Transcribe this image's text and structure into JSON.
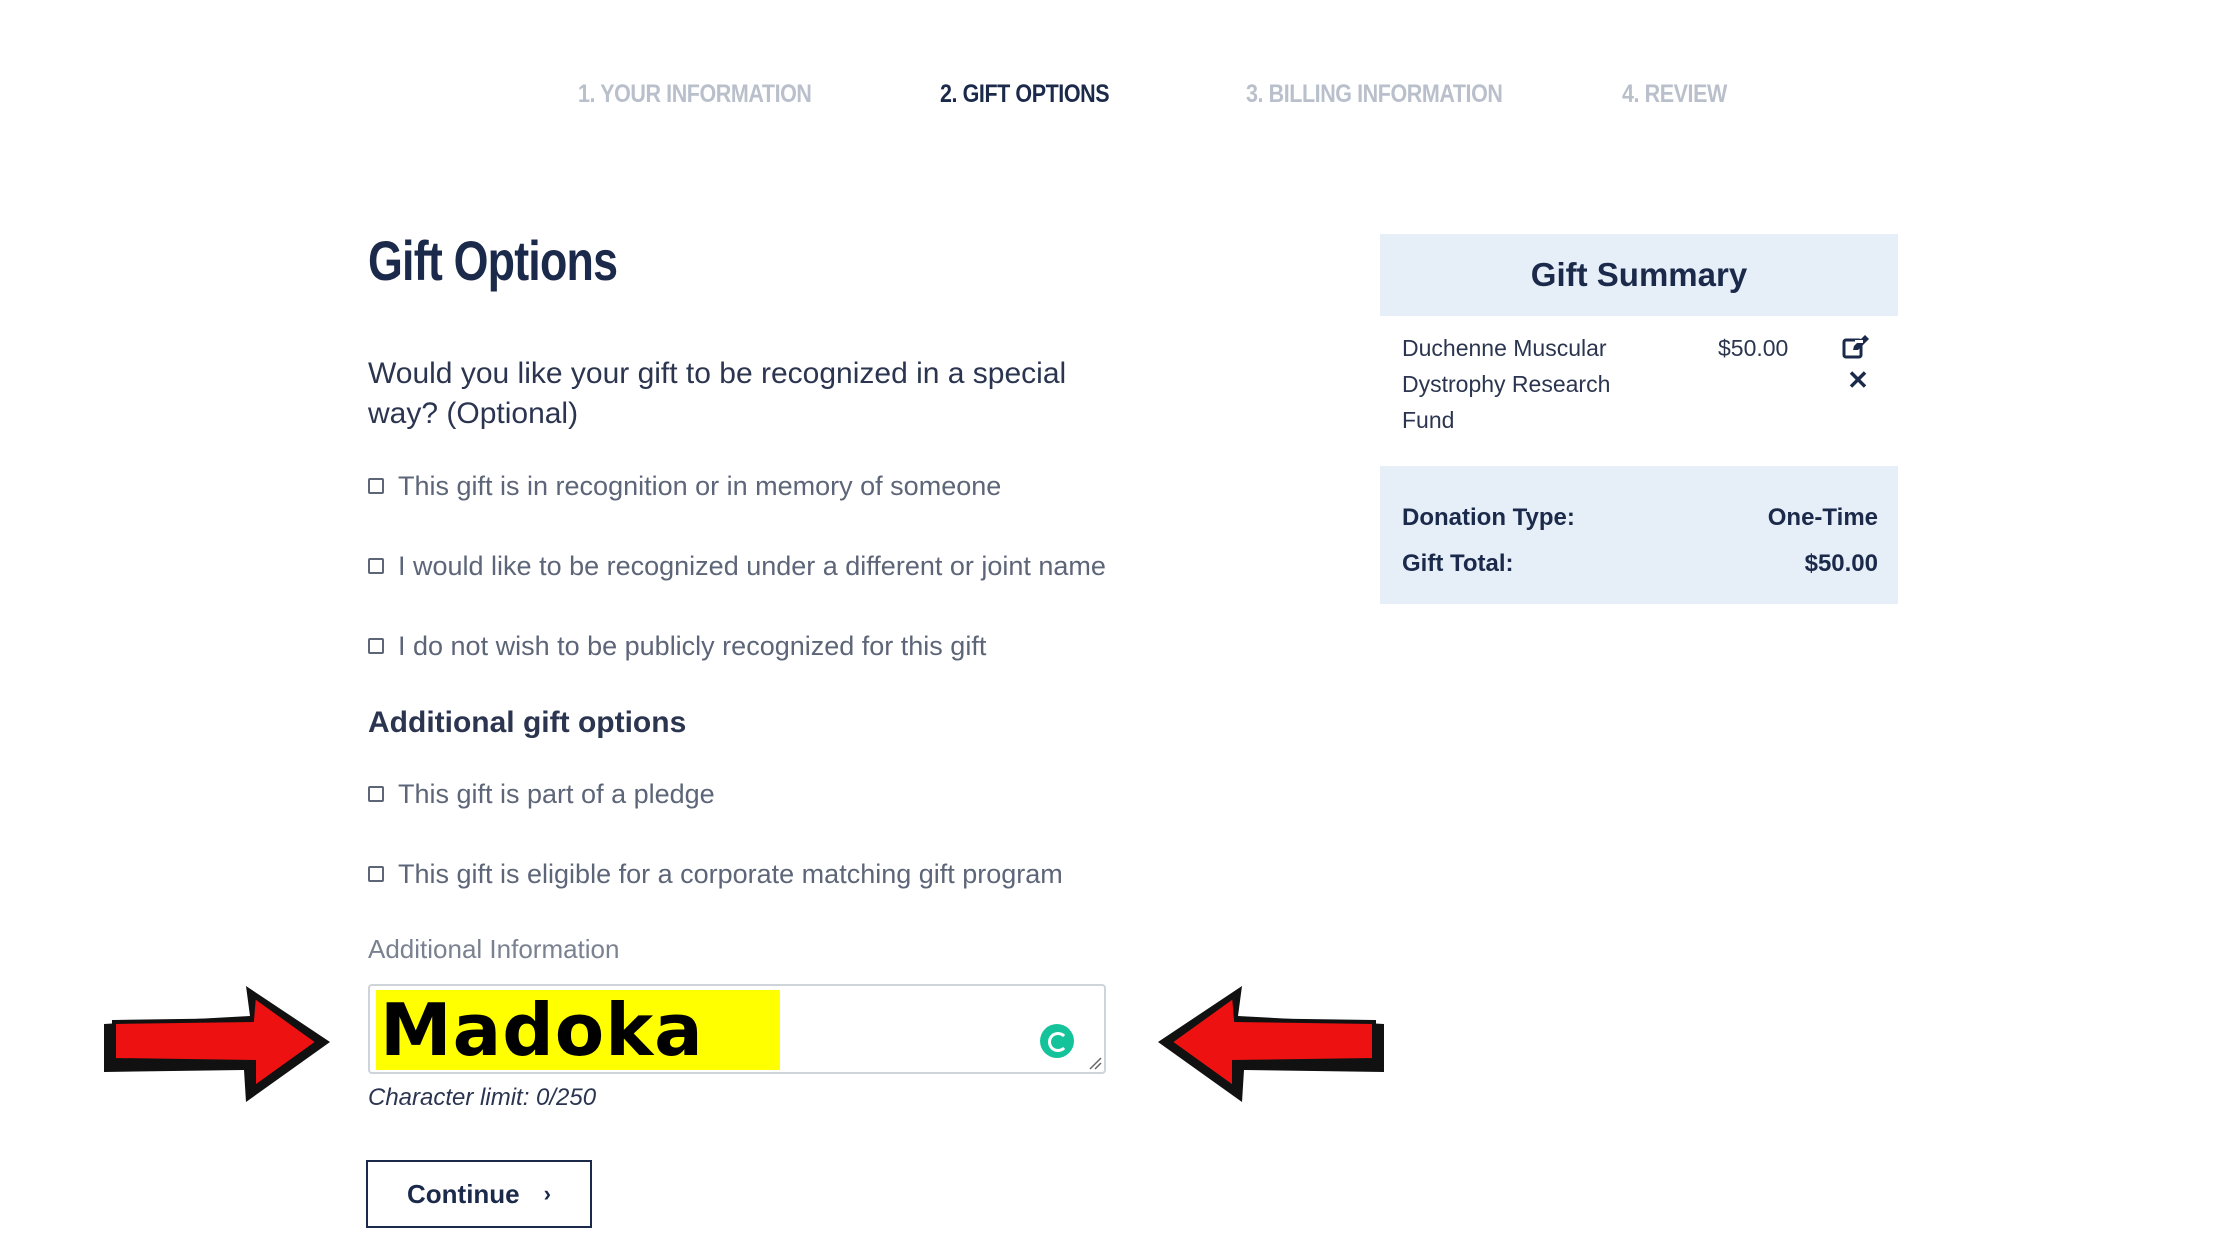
{
  "steps": [
    {
      "label": "1. YOUR INFORMATION"
    },
    {
      "label": "2. GIFT OPTIONS"
    },
    {
      "label": "3. BILLING INFORMATION"
    },
    {
      "label": "4. REVIEW"
    }
  ],
  "active_step": 2,
  "page_title": "Gift Options",
  "question": "Would you like your gift to be recognized in a special way? (Optional)",
  "recognition_options": [
    {
      "label": "This gift is in recognition or in memory of someone",
      "checked": false
    },
    {
      "label": "I would like to be recognized under a different or joint name",
      "checked": false
    },
    {
      "label": "I do not wish to be publicly recognized for this gift",
      "checked": false
    }
  ],
  "additional_title": "Additional gift options",
  "additional_options": [
    {
      "label": "This gift is part of a pledge",
      "checked": false
    },
    {
      "label": "This gift is eligible for a corporate matching gift program",
      "checked": false
    }
  ],
  "additional_info": {
    "label": "Additional Information",
    "value": "Madoka",
    "char_limit": "Character limit: 0/250"
  },
  "continue_label": "Continue",
  "summary": {
    "title": "Gift Summary",
    "fund_name": "Duchenne Muscular Dystrophy Research Fund",
    "fund_amount": "$50.00",
    "donation_type_label": "Donation Type:",
    "donation_type_value": "One-Time",
    "gift_total_label": "Gift Total:",
    "gift_total_value": "$50.00"
  },
  "icons": {
    "edit": "edit-icon",
    "remove": "close-icon",
    "chevron": "chevron-right-icon",
    "grammarly": "grammarly-icon",
    "annotation_arrows": "red-arrow"
  },
  "colors": {
    "primary": "#1b2a4a",
    "inactive_step": "#b9c0cc",
    "panel_bg": "#e6eef8",
    "highlight": "#ffff00",
    "arrow": "#ee1111",
    "grammarly": "#15c39a"
  }
}
